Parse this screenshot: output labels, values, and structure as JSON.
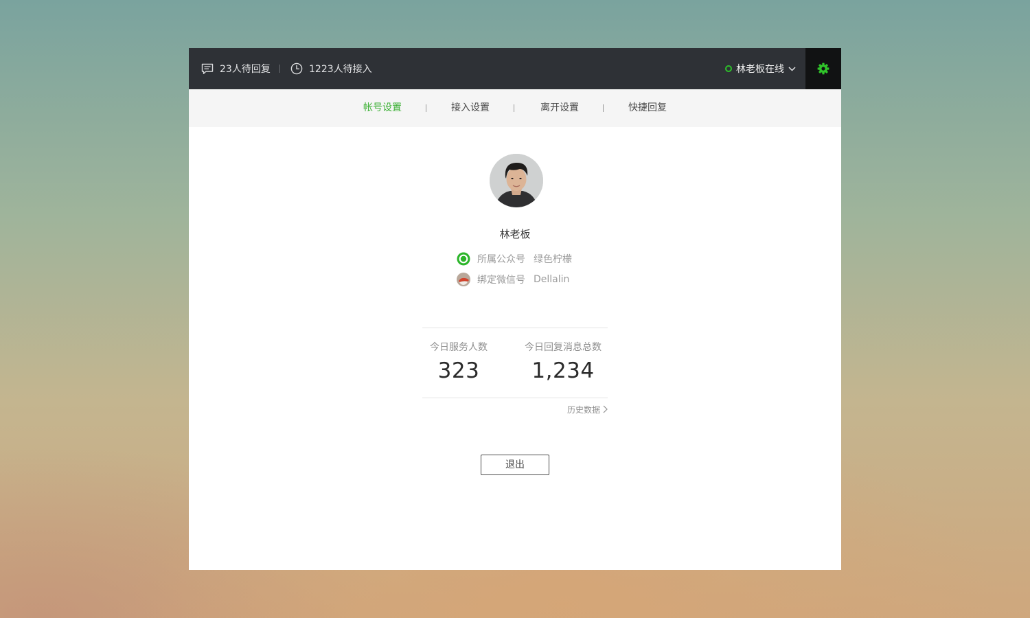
{
  "header": {
    "pending_reply": "23人待回复",
    "pending_access": "1223人待接入",
    "agent_status": "林老板在线"
  },
  "tabs": [
    {
      "label": "帐号设置",
      "active": true
    },
    {
      "label": "接入设置",
      "active": false
    },
    {
      "label": "离开设置",
      "active": false
    },
    {
      "label": "快捷回复",
      "active": false
    }
  ],
  "profile": {
    "name": "林老板",
    "official_account_label": "所属公众号",
    "official_account_value": "绿色柠檬",
    "wechat_label": "绑定微信号",
    "wechat_value": "Dellalin"
  },
  "stats": {
    "served_label": "今日服务人数",
    "served_value": "323",
    "replies_label": "今日回复消息总数",
    "replies_value": "1,234"
  },
  "history_link": "历史数据",
  "logout_label": "退出",
  "colors": {
    "accent": "#3cb035",
    "topbar": "#2e3136",
    "gear_bg": "#111213"
  },
  "icons": [
    "chat-bubble-icon",
    "clock-icon",
    "online-status-icon",
    "chevron-down-icon",
    "gear-icon",
    "official-account-icon",
    "wechat-avatar-icon",
    "chevron-right-icon"
  ]
}
